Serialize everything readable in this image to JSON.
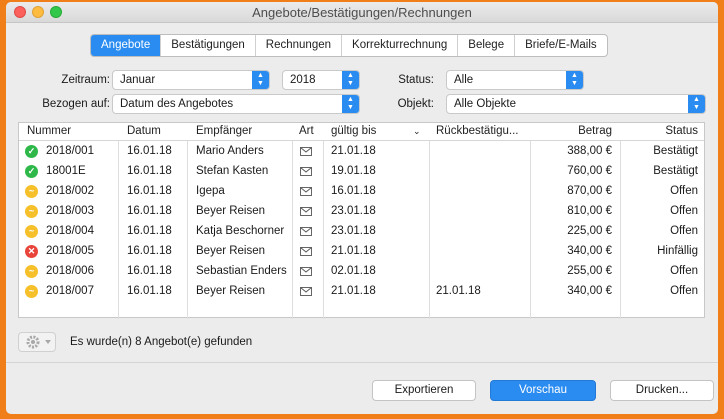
{
  "window": {
    "title": "Angebote/Bestätigungen/Rechnungen"
  },
  "tabs": [
    {
      "label": "Angebote",
      "active": true
    },
    {
      "label": "Bestätigungen",
      "active": false
    },
    {
      "label": "Rechnungen",
      "active": false
    },
    {
      "label": "Korrekturrechnung",
      "active": false
    },
    {
      "label": "Belege",
      "active": false
    },
    {
      "label": "Briefe/E-Mails",
      "active": false
    }
  ],
  "filters": {
    "zeitraum_label": "Zeitraum:",
    "zeitraum_value": "Januar",
    "year_value": "2018",
    "status_label": "Status:",
    "status_value": "Alle",
    "bezogen_label": "Bezogen auf:",
    "bezogen_value": "Datum des Angebotes",
    "objekt_label": "Objekt:",
    "objekt_value": "Alle Objekte"
  },
  "table": {
    "columns": [
      "Nummer",
      "Datum",
      "Empfänger",
      "Art",
      "gültig bis",
      "Rückbestätigu...",
      "Betrag",
      "Status"
    ],
    "rows": [
      {
        "state": "ok",
        "nummer": "2018/001",
        "datum": "16.01.18",
        "empfaenger": "Mario Anders",
        "gueltig": "21.01.18",
        "rueck": "",
        "betrag": "388,00 €",
        "status": "Bestätigt"
      },
      {
        "state": "ok",
        "nummer": "18001E",
        "datum": "16.01.18",
        "empfaenger": "Stefan Kasten",
        "gueltig": "19.01.18",
        "rueck": "",
        "betrag": "760,00 €",
        "status": "Bestätigt"
      },
      {
        "state": "open",
        "nummer": "2018/002",
        "datum": "16.01.18",
        "empfaenger": "Igepa",
        "gueltig": "16.01.18",
        "rueck": "",
        "betrag": "870,00 €",
        "status": "Offen"
      },
      {
        "state": "open",
        "nummer": "2018/003",
        "datum": "16.01.18",
        "empfaenger": "Beyer Reisen",
        "gueltig": "23.01.18",
        "rueck": "",
        "betrag": "810,00 €",
        "status": "Offen"
      },
      {
        "state": "open",
        "nummer": "2018/004",
        "datum": "16.01.18",
        "empfaenger": "Katja Beschorner",
        "gueltig": "23.01.18",
        "rueck": "",
        "betrag": "225,00 €",
        "status": "Offen"
      },
      {
        "state": "bad",
        "nummer": "2018/005",
        "datum": "16.01.18",
        "empfaenger": "Beyer Reisen",
        "gueltig": "21.01.18",
        "rueck": "",
        "betrag": "340,00 €",
        "status": "Hinfällig"
      },
      {
        "state": "open",
        "nummer": "2018/006",
        "datum": "16.01.18",
        "empfaenger": "Sebastian Enders",
        "gueltig": "02.01.18",
        "rueck": "",
        "betrag": "255,00 €",
        "status": "Offen"
      },
      {
        "state": "open",
        "nummer": "2018/007",
        "datum": "16.01.18",
        "empfaenger": "Beyer Reisen",
        "gueltig": "21.01.18",
        "rueck": "21.01.18",
        "betrag": "340,00 €",
        "status": "Offen"
      }
    ]
  },
  "footer": {
    "result_text": "Es wurde(n) 8 Angebot(e) gefunden",
    "export_label": "Exportieren",
    "preview_label": "Vorschau",
    "print_label": "Drucken..."
  },
  "colors": {
    "accent": "#2a8cf1",
    "ok": "#2fb84a",
    "open": "#f6c02a",
    "bad": "#e8443a",
    "frame": "#f07f1a"
  }
}
